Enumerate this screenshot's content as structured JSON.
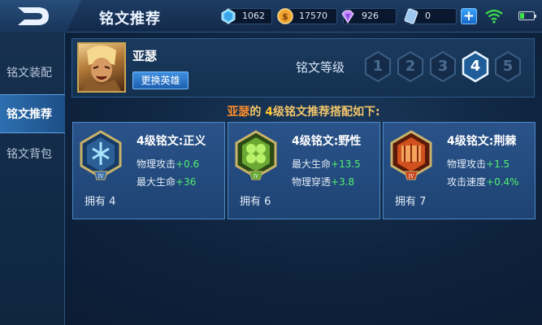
{
  "header": {
    "title": "铭文推荐",
    "resources": [
      {
        "name": "diamond",
        "value": "1062",
        "icon": "gem-icon",
        "color": "#7fd6ff"
      },
      {
        "name": "gold",
        "value": "17570",
        "icon": "coin-icon",
        "color": "#f0a431"
      },
      {
        "name": "crystal",
        "value": "926",
        "icon": "crystal-icon",
        "color": "#c58cff"
      },
      {
        "name": "ticket",
        "value": "0",
        "icon": "ticket-icon",
        "color": "#9ec7ef"
      }
    ],
    "add_label": "+"
  },
  "sidebar": {
    "items": [
      {
        "label": "铭文装配",
        "active": false
      },
      {
        "label": "铭文推荐",
        "active": true
      },
      {
        "label": "铭文背包",
        "active": false
      }
    ]
  },
  "hero": {
    "name": "亚瑟",
    "change_label": "更换英雄",
    "level_label": "铭文等级",
    "levels": [
      "1",
      "2",
      "3",
      "4",
      "5"
    ],
    "selected_level": "4"
  },
  "recommend": {
    "hero": "亚瑟",
    "connector": "的 ",
    "level": "4",
    "text": "级铭文推荐搭配如下:"
  },
  "runes": [
    {
      "name": "4级铭文:正义",
      "color": "#3b6fa8",
      "stats": [
        {
          "label": "物理攻击",
          "value": "+0.6"
        },
        {
          "label": "最大生命",
          "value": "+36"
        }
      ],
      "own": "拥有 4"
    },
    {
      "name": "4级铭文:野性",
      "color": "#5ea72f",
      "stats": [
        {
          "label": "最大生命",
          "value": "+13.5"
        },
        {
          "label": "物理穿透",
          "value": "+3.8"
        }
      ],
      "own": "拥有 6"
    },
    {
      "name": "4级铭文:荆棘",
      "color": "#c8451e",
      "stats": [
        {
          "label": "物理攻击",
          "value": "+1.5"
        },
        {
          "label": "攻击速度",
          "value": "+0.4%"
        }
      ],
      "own": "拥有 7"
    }
  ]
}
